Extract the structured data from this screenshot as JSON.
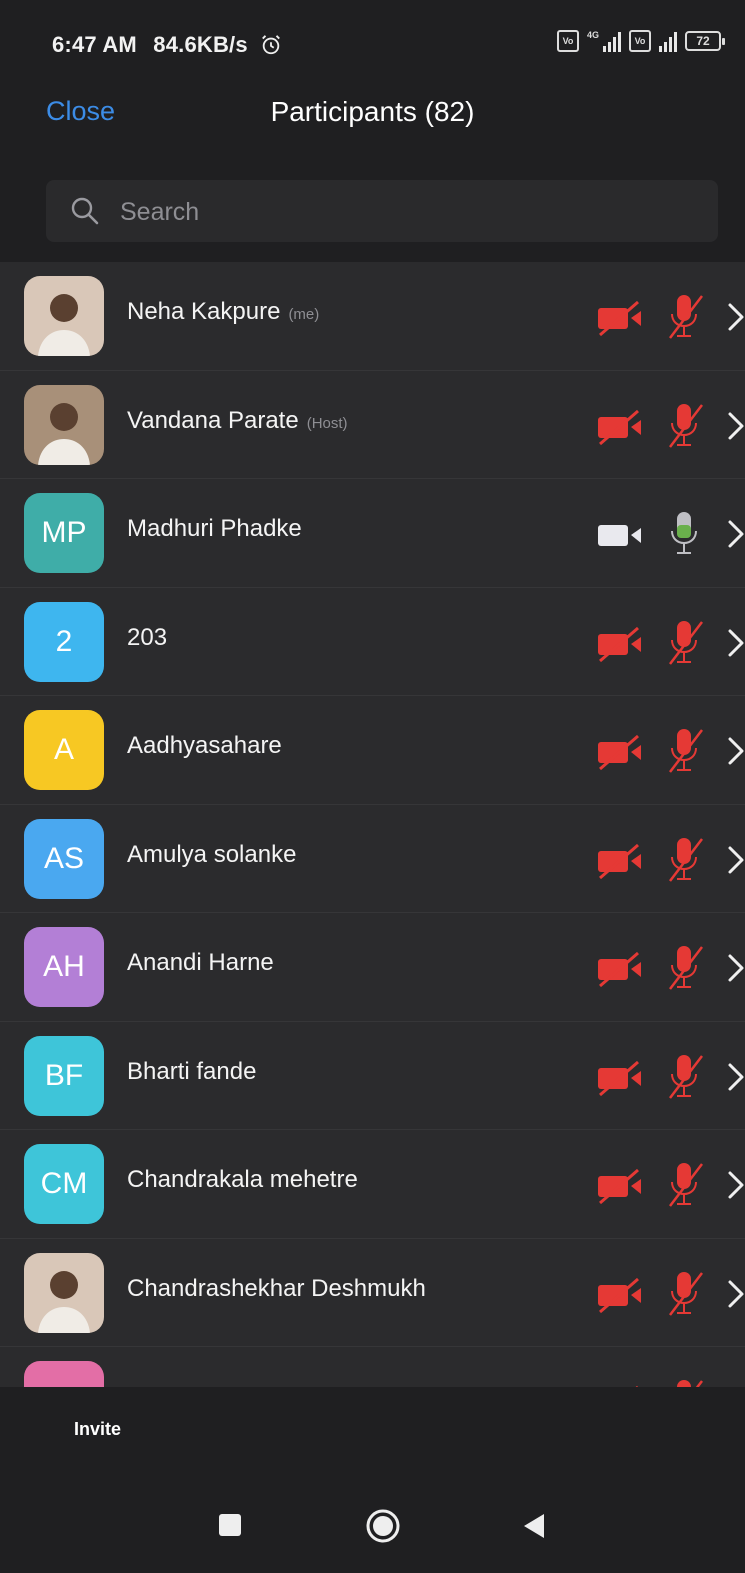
{
  "status": {
    "time": "6:47 AM",
    "speed": "84.6KB/s",
    "net": "4G",
    "battery": "72"
  },
  "header": {
    "close_label": "Close",
    "title": "Participants (82)"
  },
  "search": {
    "placeholder": "Search"
  },
  "colors": {
    "accent": "#3c8ce6",
    "muted": "#e53935",
    "active_mic": "#6ab04c",
    "bg": "#2b2b2d",
    "header_bg": "#1f1f21"
  },
  "participants": [
    {
      "name": "Neha Kakpure",
      "tag": "(me)",
      "avatar": "photo",
      "video": "off",
      "mic": "off"
    },
    {
      "name": "Vandana Parate",
      "tag": "(Host)",
      "avatar": "photo",
      "video": "off",
      "mic": "off"
    },
    {
      "name": "Madhuri Phadke",
      "tag": "",
      "initials": "MP",
      "color": "#3fada8",
      "video": "on",
      "mic": "on"
    },
    {
      "name": "203",
      "tag": "",
      "initials": "2",
      "color": "#3eb6ef",
      "video": "off",
      "mic": "off"
    },
    {
      "name": "Aadhyasahare",
      "tag": "",
      "initials": "A",
      "color": "#f7c823",
      "video": "off",
      "mic": "off"
    },
    {
      "name": "Amulya solanke",
      "tag": "",
      "initials": "AS",
      "color": "#4aa8f0",
      "video": "off",
      "mic": "off"
    },
    {
      "name": "Anandi Harne",
      "tag": "",
      "initials": "AH",
      "color": "#b37fd6",
      "video": "off",
      "mic": "off"
    },
    {
      "name": "Bharti fande",
      "tag": "",
      "initials": "BF",
      "color": "#3ec5d9",
      "video": "off",
      "mic": "off"
    },
    {
      "name": "Chandrakala mehetre",
      "tag": "",
      "initials": "CM",
      "color": "#3ec5d9",
      "video": "off",
      "mic": "off"
    },
    {
      "name": "Chandrashekhar Deshmukh",
      "tag": "",
      "avatar": "photo",
      "video": "off",
      "mic": "off"
    },
    {
      "name": "",
      "tag": "",
      "initials": "",
      "color": "#e36ea6",
      "video": "off",
      "mic": "off"
    }
  ],
  "footer": {
    "invite_label": "Invite"
  }
}
